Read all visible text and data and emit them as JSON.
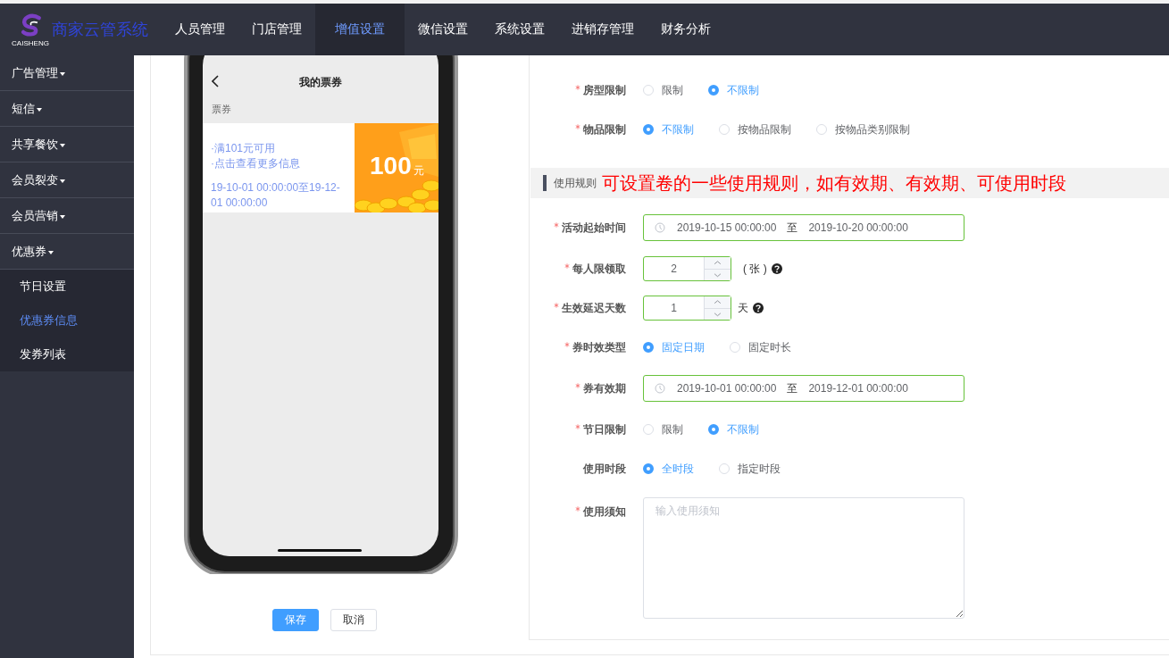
{
  "app": {
    "logo_text": "CAISHENG",
    "title": "商家云管系统"
  },
  "nav": [
    {
      "label": "人员管理",
      "selected": false
    },
    {
      "label": "门店管理",
      "selected": false
    },
    {
      "label": "增值设置",
      "selected": true
    },
    {
      "label": "微信设置",
      "selected": false
    },
    {
      "label": "系统设置",
      "selected": false
    },
    {
      "label": "进销存管理",
      "selected": false
    },
    {
      "label": "财务分析",
      "selected": false
    }
  ],
  "sidebar": {
    "items": [
      {
        "label": "广告管理"
      },
      {
        "label": "短信"
      },
      {
        "label": "共享餐饮"
      },
      {
        "label": "会员裂变"
      },
      {
        "label": "会员营销"
      },
      {
        "label": "优惠券",
        "children": [
          {
            "label": "节日设置",
            "selected": false
          },
          {
            "label": "优惠券信息",
            "selected": true
          },
          {
            "label": "发券列表",
            "selected": false
          }
        ]
      }
    ]
  },
  "phone": {
    "title": "我的票券",
    "section": "票券",
    "coupon": {
      "lines": [
        "·满101元可用",
        "·点击查看更多信息"
      ],
      "validity": "19-10-01 00:00:00至19-12-01 00:00:00",
      "amount": "100",
      "unit": "元"
    }
  },
  "form": {
    "items": [
      {
        "kind": "radio",
        "label": "房型限制",
        "required": true,
        "options": [
          {
            "label": "限制",
            "selected": false
          },
          {
            "label": "不限制",
            "selected": true
          }
        ]
      },
      {
        "kind": "radio",
        "label": "物品限制",
        "required": true,
        "options": [
          {
            "label": "不限制",
            "selected": true
          },
          {
            "label": "按物品限制",
            "selected": false
          },
          {
            "label": "按物品类别限制",
            "selected": false
          }
        ]
      },
      {
        "kind": "section",
        "title": "使用规则",
        "note": "可设置卷的一些使用规则，如有效期、有效期、可使用时段"
      },
      {
        "kind": "daterange",
        "label": "活动起始时间",
        "required": true,
        "start": "2019-10-15 00:00:00",
        "separator": "至",
        "end": "2019-10-20 00:00:00"
      },
      {
        "kind": "number",
        "label": "每人限领取",
        "required": true,
        "value": "2",
        "unit": "( 张 )",
        "help": true
      },
      {
        "kind": "number",
        "label": "生效延迟天数",
        "required": true,
        "value": "1",
        "unit": "天",
        "help": true
      },
      {
        "kind": "radio",
        "label": "券时效类型",
        "required": true,
        "options": [
          {
            "label": "固定日期",
            "selected": true
          },
          {
            "label": "固定时长",
            "selected": false
          }
        ]
      },
      {
        "kind": "daterange",
        "label": "券有效期",
        "required": true,
        "start": "2019-10-01 00:00:00",
        "separator": "至",
        "end": "2019-12-01 00:00:00"
      },
      {
        "kind": "radio",
        "label": "节日限制",
        "required": true,
        "options": [
          {
            "label": "限制",
            "selected": false
          },
          {
            "label": "不限制",
            "selected": true
          }
        ]
      },
      {
        "kind": "radio",
        "label": "使用时段",
        "required": false,
        "options": [
          {
            "label": "全时段",
            "selected": true
          },
          {
            "label": "指定时段",
            "selected": false
          }
        ]
      },
      {
        "kind": "textarea",
        "label": "使用须知",
        "required": true,
        "placeholder": "输入使用须知"
      }
    ]
  },
  "buttons": [
    {
      "label": "保存",
      "kind": "primary"
    },
    {
      "label": "取消",
      "kind": "default"
    }
  ]
}
